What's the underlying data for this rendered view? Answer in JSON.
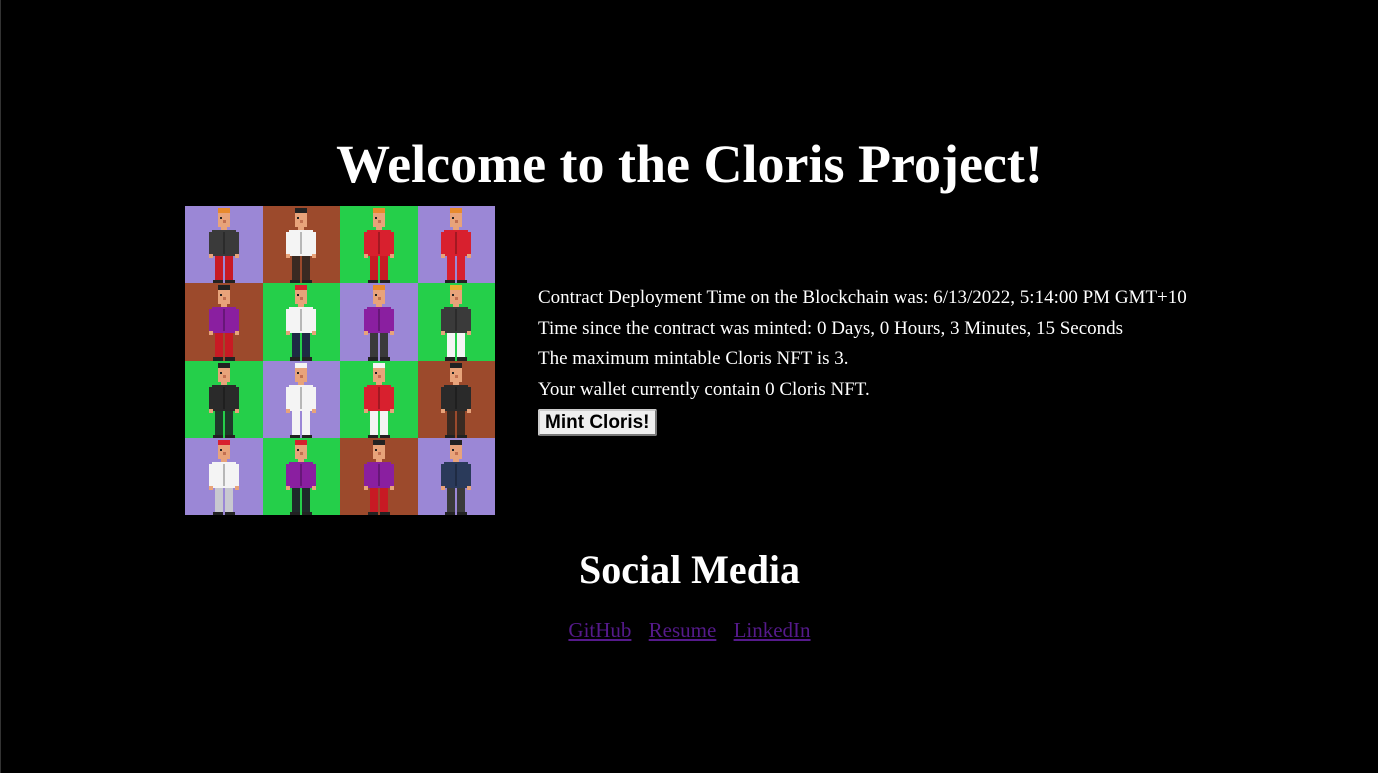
{
  "header": {
    "title": "Welcome to the Cloris Project!"
  },
  "nft_grid": {
    "tiles": [
      {
        "bg": "#9b87d6",
        "jacket": "#3a3a3a",
        "pants": "#c81a24",
        "hair": "#e88a2c"
      },
      {
        "bg": "#9c4a2c",
        "jacket": "#f4f4f4",
        "pants": "#3a2a22",
        "hair": "#222222"
      },
      {
        "bg": "#25cf4a",
        "jacket": "#d8202e",
        "pants": "#c81a24",
        "hair": "#e88a2c"
      },
      {
        "bg": "#9b87d6",
        "jacket": "#d8202e",
        "pants": "#d8202e",
        "hair": "#e88a2c"
      },
      {
        "bg": "#9c4a2c",
        "jacket": "#8a1fa0",
        "pants": "#c81a24",
        "hair": "#222222"
      },
      {
        "bg": "#25cf4a",
        "jacket": "#f4f4f4",
        "pants": "#1e2a44",
        "hair": "#d8202e"
      },
      {
        "bg": "#9b87d6",
        "jacket": "#8a1fa0",
        "pants": "#3a3a3a",
        "hair": "#e88a2c"
      },
      {
        "bg": "#25cf4a",
        "jacket": "#3a3a3a",
        "pants": "#f4f4f4",
        "hair": "#e8b030"
      },
      {
        "bg": "#25cf4a",
        "jacket": "#2a2a2a",
        "pants": "#1e3a2a",
        "hair": "#222222"
      },
      {
        "bg": "#9b87d6",
        "jacket": "#f4f4f4",
        "pants": "#f4f4f4",
        "hair": "#f4f4f4"
      },
      {
        "bg": "#25cf4a",
        "jacket": "#d8202e",
        "pants": "#f4f4f4",
        "hair": "#f4f4f4"
      },
      {
        "bg": "#9c4a2c",
        "jacket": "#2a2a2a",
        "pants": "#3a2a22",
        "hair": "#222222"
      },
      {
        "bg": "#9b87d6",
        "jacket": "#f4f4f4",
        "pants": "#c8c8d0",
        "hair": "#d8202e"
      },
      {
        "bg": "#25cf4a",
        "jacket": "#8a1fa0",
        "pants": "#1e2a2a",
        "hair": "#d8202e"
      },
      {
        "bg": "#9c4a2c",
        "jacket": "#8a1fa0",
        "pants": "#c81a24",
        "hair": "#222222"
      },
      {
        "bg": "#9b87d6",
        "jacket": "#2a3a5a",
        "pants": "#3a3a3a",
        "hair": "#222222"
      }
    ]
  },
  "contract_info": {
    "deployment_time": "Contract Deployment Time on the Blockchain was: 6/13/2022, 5:14:00 PM GMT+10",
    "time_since_minted": "Time since the contract was minted: 0 Days, 0 Hours, 3 Minutes, 15 Seconds",
    "max_mintable": "The maximum mintable Cloris NFT is 3.",
    "wallet_count": "Your wallet currently contain 0 Cloris NFT.",
    "mint_button_label": "Mint Cloris!"
  },
  "social": {
    "heading": "Social Media",
    "links": {
      "github": "GitHub",
      "resume": "Resume",
      "linkedin": "LinkedIn"
    }
  }
}
